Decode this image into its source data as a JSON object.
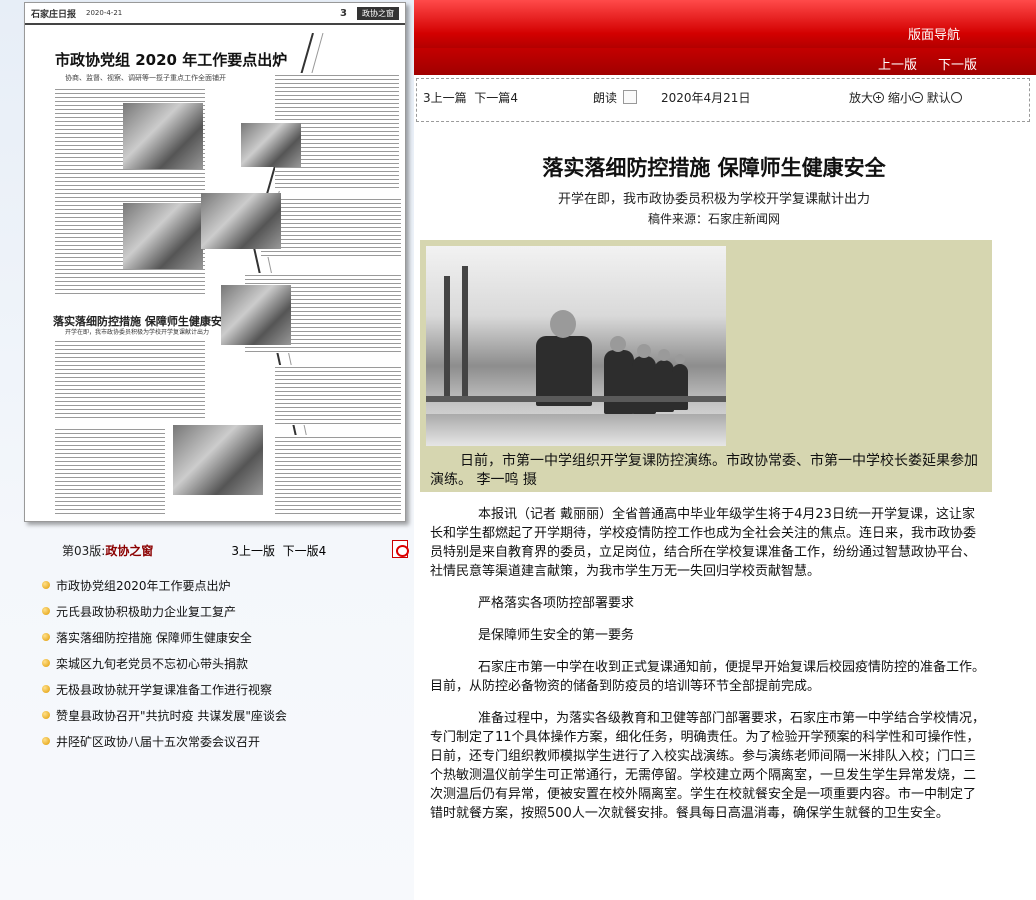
{
  "left": {
    "newspaper": {
      "masthead": "石家庄日报",
      "date": "2020-4-21",
      "page_no": "3",
      "section": "政协之窗",
      "headline": "市政协党组 2020 年工作要点出炉",
      "subhead": "协商、监督、视察、调研等一揽子重点工作全面铺开",
      "headline2": "落实落细防控措施 保障师生健康安全",
      "subhead2": "开学在即，我市政协委员积极为学校开学复课献计出力"
    },
    "page_label": "第03版:",
    "page_name": "政协之窗",
    "prev_page": "上一版",
    "next_page": "下一版",
    "prev_num": "3",
    "next_num": "4",
    "articles": [
      "市政协党组2020年工作要点出炉",
      "元氏县政协积极助力企业复工复产",
      "落实落细防控措施 保障师生健康安全",
      "栾城区九旬老党员不忘初心带头捐款",
      "无极县政协就开学复课准备工作进行视察",
      "赞皇县政协召开\"共抗时疫 共谋发展\"座谈会",
      "井陉矿区政协八届十五次常委会议召开"
    ]
  },
  "right": {
    "nav_title": "版面导航",
    "prev_edition": "上一版",
    "next_edition": "下一版",
    "toolbar": {
      "prev_num": "3",
      "prev_article": "上一篇",
      "next_article": "下一篇",
      "next_num": "4",
      "read_aloud": "朗读",
      "date": "2020年4月21日",
      "zoom_in": "放大",
      "zoom_out": "缩小",
      "default": "默认"
    },
    "article": {
      "title": "落实落细防控措施 保障师生健康安全",
      "subtitle": "开学在即，我市政协委员积极为学校开学复课献计出力",
      "source": "稿件来源：石家庄新闻网",
      "caption": "日前，市第一中学组织开学复课防控演练。市政协常委、市第一中学校长娄延果参加演练。 李一鸣 摄",
      "paragraphs": [
        "本报讯（记者 戴丽丽）全省普通高中毕业年级学生将于4月23日统一开学复课，这让家长和学生都燃起了开学期待，学校疫情防控工作也成为全社会关注的焦点。连日来，我市政协委员特别是来自教育界的委员，立足岗位，结合所在学校复课准备工作，纷纷通过智慧政协平台、社情民意等渠道建言献策，为我市学生万无一失回归学校贡献智慧。",
        "严格落实各项防控部署要求",
        "是保障师生安全的第一要务",
        "石家庄市第一中学在收到正式复课通知前，便提早开始复课后校园疫情防控的准备工作。目前，从防控必备物资的储备到防疫员的培训等环节全部提前完成。",
        "准备过程中，为落实各级教育和卫健等部门部署要求，石家庄市第一中学结合学校情况，专门制定了11个具体操作方案，细化任务，明确责任。为了检验开学预案的科学性和可操作性，日前，还专门组织教师模拟学生进行了入校实战演练。参与演练老师间隔一米排队入校；门口三个热敏测温仪前学生可正常通行，无需停留。学校建立两个隔离室，一旦发生学生异常发烧，二次测温后仍有异常，便被安置在校外隔离室。学生在校就餐安全是一项重要内容。市一中制定了错时就餐方案，按照500人一次就餐安排。餐具每日高温消毒，确保学生就餐的卫生安全。"
      ]
    }
  }
}
